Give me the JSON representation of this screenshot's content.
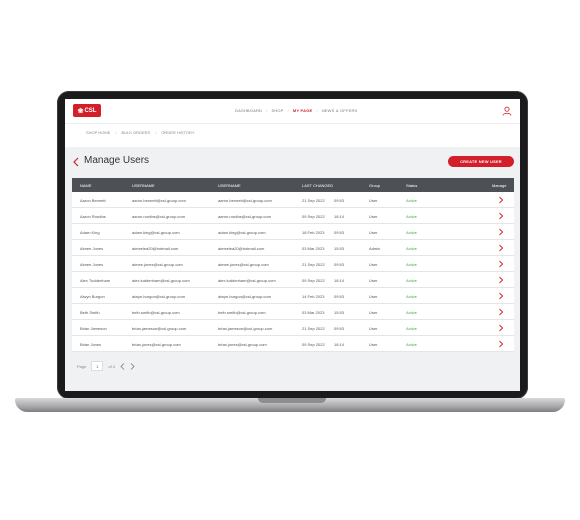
{
  "brand": {
    "logo_text": "CSL",
    "color": "#d31f2a"
  },
  "nav": {
    "items": [
      {
        "label": "DASHBOARD",
        "active": false
      },
      {
        "label": "SHOP",
        "active": false
      },
      {
        "label": "MY PAGE",
        "active": true
      },
      {
        "label": "NEWS & OFFERS",
        "active": false
      }
    ],
    "separator": "/"
  },
  "subnav": {
    "items": [
      "SHOP HOME",
      "BULK ORDERS",
      "ORDER HISTORY"
    ],
    "separator": "/"
  },
  "page": {
    "title": "Manage Users",
    "create_button": "CREATE NEW USER"
  },
  "table": {
    "headers": [
      "NAME",
      "USERNAME",
      "USERNAME",
      "LAST CHANGED",
      "Group",
      "Status",
      "Manage"
    ],
    "rows": [
      {
        "name": "Aaron Bennett",
        "email1": "aaron.bennett@csl-group.com",
        "email2": "aaron.bennett@csl-group.com",
        "date": "21 Sep 2022",
        "time": "09:53",
        "group": "User",
        "status": "Active"
      },
      {
        "name": "Aaron Rowlins",
        "email1": "aaron.rowlins@csl-group.com",
        "email2": "aaron.rowlins@csl-group.com",
        "date": "09 Sep 2022",
        "time": "18:14",
        "group": "User",
        "status": "Active"
      },
      {
        "name": "Adam King",
        "email1": "adam.king@csl-group.com",
        "email2": "adam.king@csl-group.com",
        "date": "18 Feb 2023",
        "time": "09:53",
        "group": "User",
        "status": "Active"
      },
      {
        "name": "Aimee Jones",
        "email1": "aimeelea20@hotmail.com",
        "email2": "aimeelea20@hotmail.com",
        "date": "03 Mar 2023",
        "time": "15:53",
        "group": "Admin",
        "status": "Active"
      },
      {
        "name": "Aimee Jones",
        "email1": "aimee.jones@csl-group.com",
        "email2": "aimee.jones@csl-group.com",
        "date": "21 Sep 2022",
        "time": "09:53",
        "group": "User",
        "status": "Active"
      },
      {
        "name": "Alex Tuddenham",
        "email1": "alex.tuddenham@csl-group.com",
        "email2": "alex.tuddenham@csl-group.com",
        "date": "09 Sep 2022",
        "time": "18:14",
        "group": "User",
        "status": "Active"
      },
      {
        "name": "Alwyn Burgon",
        "email1": "alwyn.burgon@csl-group.com",
        "email2": "alwyn.burgon@csl-group.com",
        "date": "14 Feb 2023",
        "time": "09:53",
        "group": "User",
        "status": "Active"
      },
      {
        "name": "Beth Smith",
        "email1": "beth.smith@csl-group.com",
        "email2": "beth.smith@csl-group.com",
        "date": "03 Mar 2023",
        "time": "15:53",
        "group": "User",
        "status": "Active"
      },
      {
        "name": "Brian Jameson",
        "email1": "brian.jameson@csl-group.com",
        "email2": "brian.jameson@csl-group.com",
        "date": "21 Sep 2022",
        "time": "09:53",
        "group": "User",
        "status": "Active"
      },
      {
        "name": "Brian Jones",
        "email1": "brian.jones@csl-group.com",
        "email2": "brian.jones@csl-group.com",
        "date": "09 Sep 2022",
        "time": "18:14",
        "group": "User",
        "status": "Active"
      }
    ]
  },
  "pagination": {
    "label": "Page",
    "current": "1",
    "total_text": "of 4"
  },
  "colors": {
    "accent": "#d31f2a",
    "header_bg": "#4d5156",
    "active_status": "#3fae49",
    "page_bg": "#f0f1f2"
  }
}
